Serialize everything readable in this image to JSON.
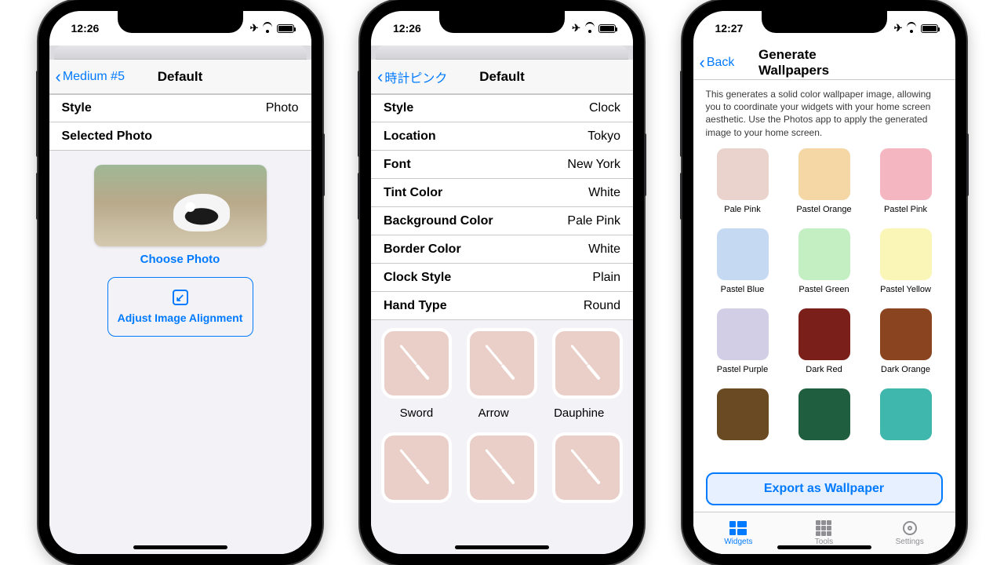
{
  "p1": {
    "time": "12:26",
    "back": "Medium #5",
    "title": "Default",
    "rows": [
      {
        "l": "Style",
        "v": "Photo"
      },
      {
        "l": "Selected Photo",
        "v": ""
      }
    ],
    "choose": "Choose Photo",
    "adjust": "Adjust Image Alignment"
  },
  "p2": {
    "time": "12:26",
    "back": "時計ピンク",
    "title": "Default",
    "rows": [
      {
        "l": "Style",
        "v": "Clock"
      },
      {
        "l": "Location",
        "v": "Tokyo"
      },
      {
        "l": "Font",
        "v": "New York"
      },
      {
        "l": "Tint Color",
        "v": "White"
      },
      {
        "l": "Background Color",
        "v": "Pale Pink"
      },
      {
        "l": "Border Color",
        "v": "White"
      },
      {
        "l": "Clock Style",
        "v": "Plain"
      },
      {
        "l": "Hand Type",
        "v": "Round"
      }
    ],
    "hands": [
      "Sword",
      "Arrow",
      "Dauphine"
    ]
  },
  "p3": {
    "time": "12:27",
    "back": "Back",
    "title": "Generate Wallpapers",
    "desc": "This generates a solid color wallpaper image, allowing you to coordinate your widgets with your home screen aesthetic.  Use the Photos app to apply the generated image to your home screen.",
    "swatches": [
      {
        "n": "Pale Pink",
        "c": "#ead3cd"
      },
      {
        "n": "Pastel Orange",
        "c": "#f5d7a6"
      },
      {
        "n": "Pastel Pink",
        "c": "#f4b7c1"
      },
      {
        "n": "Pastel Blue",
        "c": "#c6d9f2"
      },
      {
        "n": "Pastel Green",
        "c": "#c3efc3"
      },
      {
        "n": "Pastel Yellow",
        "c": "#f9f6b8"
      },
      {
        "n": "Pastel Purple",
        "c": "#d1cee6"
      },
      {
        "n": "Dark Red",
        "c": "#7a1f1a"
      },
      {
        "n": "Dark Orange",
        "c": "#8a4520"
      },
      {
        "n": "",
        "c": "#6a4a22"
      },
      {
        "n": "",
        "c": "#1f5e3e"
      },
      {
        "n": "",
        "c": "#3fb7ac"
      }
    ],
    "export": "Export as Wallpaper",
    "tabs": [
      {
        "n": "Widgets"
      },
      {
        "n": "Tools"
      },
      {
        "n": "Settings"
      }
    ]
  }
}
